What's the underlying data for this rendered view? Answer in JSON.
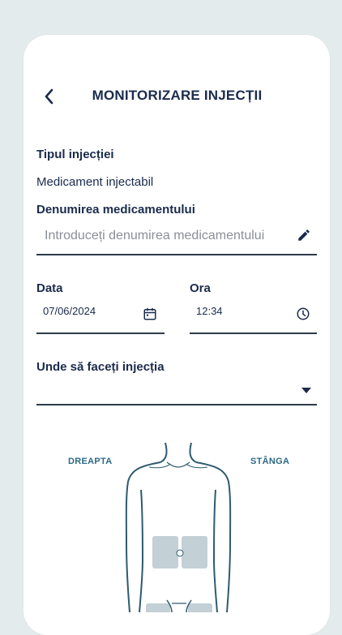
{
  "header": {
    "title": "MONITORIZARE INJECȚII"
  },
  "form": {
    "injection_type_label": "Tipul injecției",
    "injection_type_value": "Medicament injectabil",
    "medicine_name_label": "Denumirea medicamentului",
    "medicine_name_placeholder": "Introduceți denumirea medicamentului",
    "date_label": "Data",
    "date_value": "07/06/2024",
    "time_label": "Ora",
    "time_value": "12:34",
    "site_label": "Unde să faceți injecția",
    "site_value": ""
  },
  "body_map": {
    "right_label": "DREAPTA",
    "left_label": "STÂNGA",
    "outline_color": "#2d5b6e",
    "zone_color": "#c3d0d6"
  },
  "icons": {
    "back": "chevron-left-icon",
    "edit": "pencil-icon",
    "calendar": "calendar-icon",
    "clock": "clock-icon",
    "dropdown": "caret-down-icon"
  },
  "colors": {
    "background": "#e4ebed",
    "card": "#ffffff",
    "text": "#1a2b4c",
    "accent": "#2d6a86"
  }
}
